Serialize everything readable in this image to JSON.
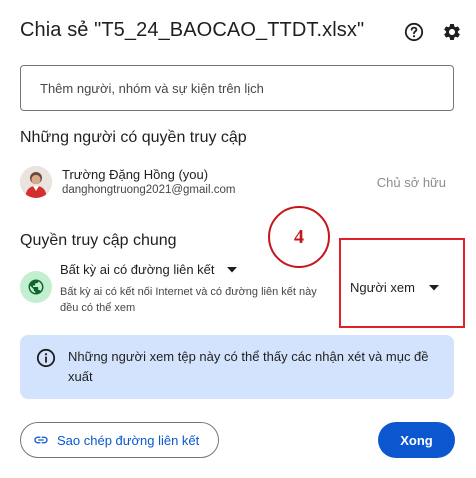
{
  "dialog": {
    "title": "Chia sẻ \"T5_24_BAOCAO_TTDT.xlsx\"",
    "help_icon": "help-circle-icon",
    "settings_icon": "gear-icon"
  },
  "share_input": {
    "placeholder": "Thêm người, nhóm và sự kiện trên lịch"
  },
  "people_section": {
    "title": "Những người có quyền truy cập",
    "users": [
      {
        "name": "Trường Đặng Hồng (you)",
        "email": "danghongtruong2021@gmail.com",
        "role": "Chủ sở hữu"
      }
    ]
  },
  "general_access": {
    "title": "Quyền truy cập chung",
    "icon": "globe-icon",
    "selected": "Bất kỳ ai có đường liên kết",
    "description": "Bất kỳ ai có kết nối Internet và có đường liên kết này đều có thể xem",
    "role": "Người xem"
  },
  "annotation": {
    "step_number": "4",
    "color": "#c4161c",
    "box_color": "#e2202a"
  },
  "info_banner": {
    "icon": "info-icon",
    "text": "Những người xem tệp này có thể thấy các nhận xét và mục đề xuất"
  },
  "footer": {
    "copy_link_label": "Sao chép đường liên kết",
    "copy_link_icon": "link-icon",
    "done_label": "Xong"
  },
  "colors": {
    "accent": "#0b57d0",
    "banner_bg": "#d3e3fd",
    "globe_bg": "#c4eed0"
  }
}
